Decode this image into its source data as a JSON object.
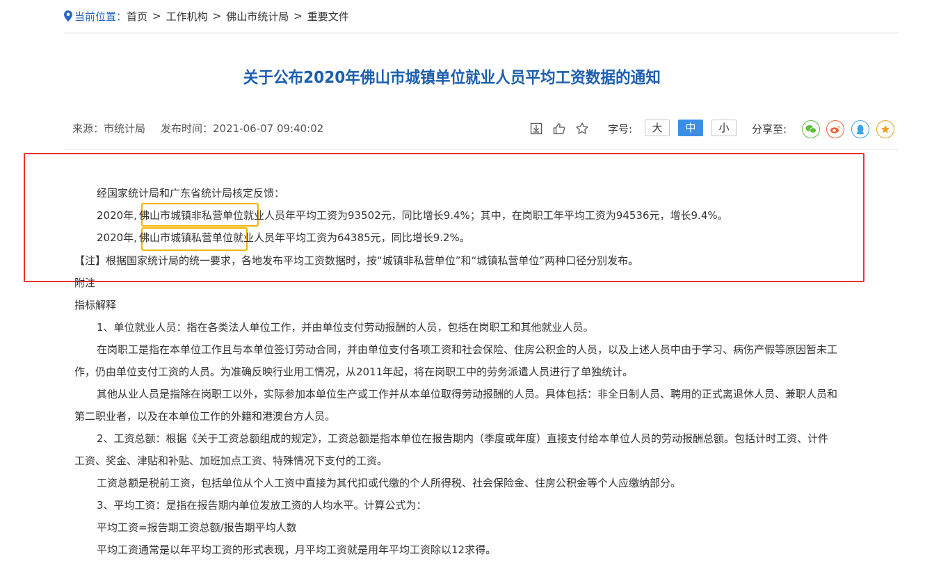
{
  "breadcrumb": {
    "lead": "当前位置：",
    "items": [
      "首页",
      "工作机构",
      "佛山市统计局",
      "重要文件"
    ],
    "separator": ">"
  },
  "article": {
    "title": "关于公布2020年佛山市城镇单位就业人员平均工资数据的通知",
    "source": "来源：市统计局",
    "published": "发布时间：2021-06-07 09:40:02"
  },
  "toolbar": {
    "font_label": "字号:",
    "sizes": [
      "大",
      "中",
      "小"
    ],
    "active_size": "中",
    "share_label": "分享至:"
  },
  "colors": {
    "title": "#1b5fb0",
    "breadcrumb_lead": "#2968c8",
    "active_button": "#3b8ee6",
    "red_box": "#e8332b",
    "highlight": "#f2b300"
  },
  "body": {
    "l1": "经国家统计局和广东省统计局核定反馈：",
    "l2a": "2020年,",
    "l2b": "佛山市城镇非私营单位",
    "l2c": "就业人员年平均工资为93502元，同比增长9.4%；其中，在岗职工年平均工资为94536元，增长9.4%。",
    "l3a": "2020年,",
    "l3b": "佛山市城镇私营单位",
    "l3c": "就业人员年平均工资为64385元，同比增长9.2%。",
    "l4": "【注】根据国家统计局的统一要求，各地发布平均工资数据时，按“城镇非私营单位”和“城镇私营单位”两种口径分别发布。",
    "l5": "附注",
    "l6": "指标解释",
    "l7": "1、单位就业人员：指在各类法人单位工作，并由单位支付劳动报酬的人员，包括在岗职工和其他就业人员。",
    "l8": "在岗职工是指在本单位工作且与本单位签订劳动合同，并由单位支付各项工资和社会保险、住房公积金的人员，以及上述人员中由于学习、病伤产假等原因暂未工",
    "l9": "作，仍由单位支付工资的人员。为准确反映行业用工情况，从2011年起，将在岗职工中的劳务派遣人员进行了单独统计。",
    "l10": "其他从业人员是指除在岗职工以外，实际参加本单位生产或工作并从本单位取得劳动报酬的人员。具体包括：非全日制人员、聘用的正式离退休人员、兼职人员和",
    "l11": "第二职业者，以及在本单位工作的外籍和港澳台方人员。",
    "l12": "2、工资总额：根据《关于工资总额组成的规定》，工资总额是指本单位在报告期内（季度或年度）直接支付给本单位人员的劳动报酬总额。包括计时工资、计件",
    "l13": "工资、奖金、津贴和补贴、加班加点工资、特殊情况下支付的工资。",
    "l14": "工资总额是税前工资，包括单位从个人工资中直接为其代扣或代缴的个人所得税、社会保险金、住房公积金等个人应缴纳部分。",
    "l15": "3、平均工资：是指在报告期内单位发放工资的人均水平。计算公式为：",
    "l16": "平均工资=报告期工资总额/报告期平均人数",
    "l17": "平均工资通常是以年平均工资的形式表现，月平均工资就是用年平均工资除以12求得。"
  }
}
